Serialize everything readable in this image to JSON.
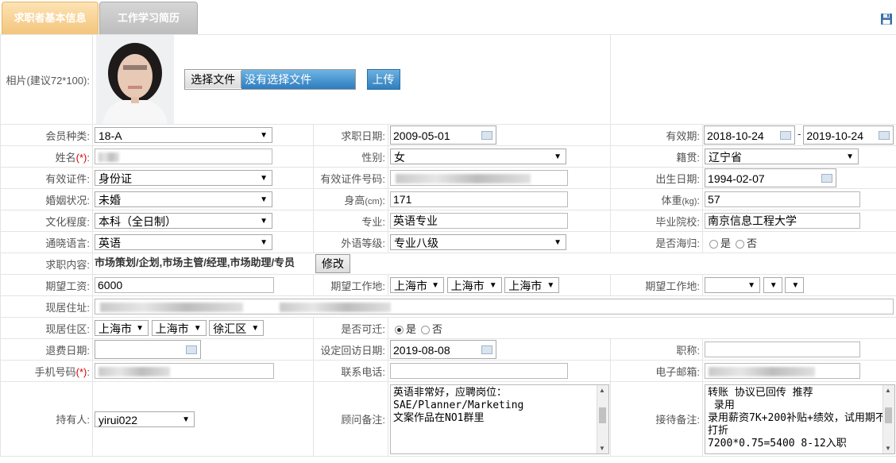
{
  "tabs": {
    "basic_info": "求职者基本信息",
    "work_study": "工作学习简历"
  },
  "photo": {
    "label": "相片(建议72*100):",
    "choose_btn": "选择文件",
    "no_file": "没有选择文件",
    "upload_btn": "上传"
  },
  "member_type": {
    "label": "会员种类:",
    "value": "18-A"
  },
  "job_date": {
    "label": "求职日期:",
    "value": "2009-05-01"
  },
  "valid_period": {
    "label": "有效期:",
    "start": "2018-10-24",
    "sep": "-",
    "end": "2019-10-24"
  },
  "name": {
    "label": "姓名",
    "req": "(*)",
    "colon": ":"
  },
  "gender": {
    "label": "性别:",
    "value": "女"
  },
  "native_place": {
    "label": "籍贯:",
    "value": "辽宁省"
  },
  "id_type": {
    "label": "有效证件:",
    "value": "身份证"
  },
  "id_number": {
    "label": "有效证件号码:"
  },
  "birth_date": {
    "label": "出生日期:",
    "value": "1994-02-07"
  },
  "marital": {
    "label": "婚姻状况:",
    "value": "未婚"
  },
  "height": {
    "label": "身高",
    "unit": "(cm)",
    "colon": ":",
    "value": "171"
  },
  "weight": {
    "label": "体重",
    "unit": "(kg)",
    "colon": ":",
    "value": "57"
  },
  "education": {
    "label": "文化程度:",
    "value": "本科（全日制）"
  },
  "major": {
    "label": "专业:",
    "value": "英语专业"
  },
  "school": {
    "label": "毕业院校:",
    "value": "南京信息工程大学"
  },
  "language": {
    "label": "通晓语言:",
    "value": "英语"
  },
  "lang_level": {
    "label": "外语等级:",
    "value": "专业八级"
  },
  "returnee": {
    "label": "是否海归:",
    "yes": "是",
    "no": "否"
  },
  "job_content": {
    "label": "求职内容:",
    "value": "市场策划/企划,市场主管/经理,市场助理/专员",
    "modify_btn": "修改"
  },
  "expected_salary": {
    "label": "期望工资:",
    "value": "6000"
  },
  "expected_location": {
    "label": "期望工作地:",
    "province": "上海市",
    "city": "上海市",
    "district": "上海市"
  },
  "expected_location2": {
    "label": "期望工作地:"
  },
  "address": {
    "label": "现居住址:"
  },
  "residence": {
    "label": "现居住区:",
    "province": "上海市",
    "city": "上海市",
    "district": "徐汇区"
  },
  "relocate": {
    "label": "是否可迁:",
    "yes": "是",
    "no": "否"
  },
  "refund_date": {
    "label": "退费日期:"
  },
  "revisit_date": {
    "label": "设定回访日期:",
    "value": "2019-08-08"
  },
  "title": {
    "label": "职称:"
  },
  "mobile": {
    "label": "手机号码",
    "req": "(*)",
    "colon": ":"
  },
  "phone": {
    "label": "联系电话:"
  },
  "email": {
    "label": "电子邮箱:"
  },
  "holder": {
    "label": "持有人:",
    "value": "yirui022"
  },
  "consultant_note": {
    "label": "顾问备注:",
    "value": "英语非常好，应聘岗位：\nSAE/Planner/Marketing\n文案作品在NO1群里"
  },
  "reception_note": {
    "label": "接待备注:",
    "value": "转账 协议已回传 推荐\n 录用\n录用薪资7K+200补贴+绩效，试用期不打折\n7200*0.75=5400 8-12入职"
  }
}
